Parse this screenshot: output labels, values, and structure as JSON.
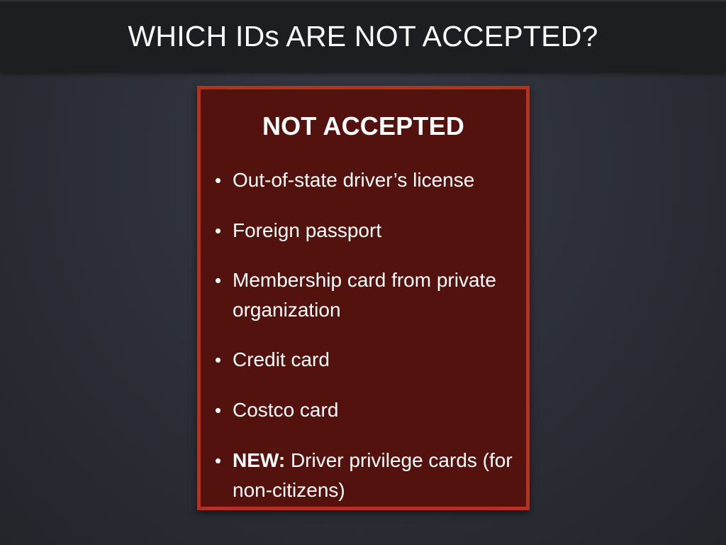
{
  "slide": {
    "title": "WHICH IDs ARE NOT ACCEPTED?"
  },
  "card": {
    "heading": "NOT ACCEPTED",
    "bullet_glyph": "•",
    "items": [
      {
        "prefix": "",
        "text": "Out-of-state driver’s license"
      },
      {
        "prefix": "",
        "text": "Foreign passport"
      },
      {
        "prefix": "",
        "text": "Membership card from private organization"
      },
      {
        "prefix": "",
        "text": "Credit card"
      },
      {
        "prefix": "",
        "text": "Costco card"
      },
      {
        "prefix": "NEW:",
        "text": "Driver privilege cards (for non-citizens)"
      }
    ]
  },
  "colors": {
    "title_bar": "#1d1e21",
    "card_fill": "#53120e",
    "card_border": "#b6321e",
    "text": "#ffffff"
  }
}
